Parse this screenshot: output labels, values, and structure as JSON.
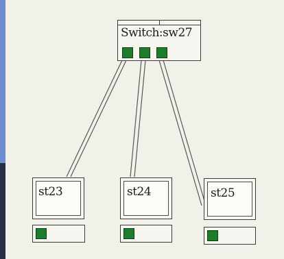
{
  "switch": {
    "label": "Switch:sw27",
    "port_count": 3
  },
  "stations": [
    {
      "label": "st23",
      "port_count": 1
    },
    {
      "label": "st24",
      "port_count": 1
    },
    {
      "label": "st25",
      "port_count": 1
    }
  ],
  "colors": {
    "background": "#f2f1e9",
    "port_green": "#1e7d2a",
    "border": "#3a3a3a",
    "accent_bar": "#6f8ed1"
  }
}
